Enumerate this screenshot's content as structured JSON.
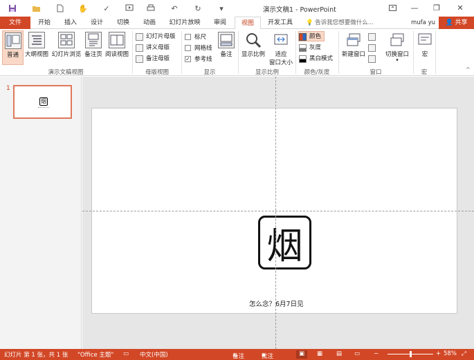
{
  "window": {
    "title": "演示文稿1 - PowerPoint"
  },
  "tabs": {
    "file": "文件",
    "items": [
      "开始",
      "插入",
      "设计",
      "切换",
      "动画",
      "幻灯片放映",
      "审阅",
      "视图",
      "开发工具"
    ],
    "active": "视图",
    "tell_me": "告诉我您想要做什么...",
    "user": "mufa yu",
    "share": "共享"
  },
  "ribbon": {
    "views": {
      "normal": "普通",
      "outline": "大纲视图",
      "sorter": "幻灯片浏览",
      "notes_page": "备注页",
      "reading": "阅读视图",
      "label": "演示文稿视图"
    },
    "masters": {
      "slide_master": "幻灯片母版",
      "handout_master": "讲义母版",
      "notes_master": "备注母版",
      "label": "母版视图"
    },
    "show": {
      "ruler": "标尺",
      "gridlines": "网格线",
      "guides": "参考线",
      "notes": "备注",
      "label": "显示"
    },
    "zoom": {
      "zoom": "显示比例",
      "fit_line1": "适应",
      "fit_line2": "窗口大小",
      "label": "显示比例"
    },
    "color": {
      "color": "颜色",
      "grayscale": "灰度",
      "bw": "黑白模式",
      "label": "颜色/灰度"
    },
    "window": {
      "new_window": "新建窗口",
      "switch": "切换窗口",
      "label": "窗口"
    },
    "macros": {
      "macros": "宏",
      "label": "宏"
    }
  },
  "thumbnails": {
    "number": "1",
    "glyph": "烟"
  },
  "slide": {
    "glyph": "烟",
    "subtitle": "怎么念？6月7日见"
  },
  "status": {
    "slide_info": "幻灯片 第 1 张，共 1 张",
    "theme": "\"Office 主题\"",
    "language": "中文(中国)",
    "notes": "备注",
    "comments": "批注",
    "zoom": "58%"
  },
  "colors": {
    "accent": "#d24726",
    "active_tab_text": "#c43e1c",
    "selected_fill": "#f9d8c7"
  }
}
